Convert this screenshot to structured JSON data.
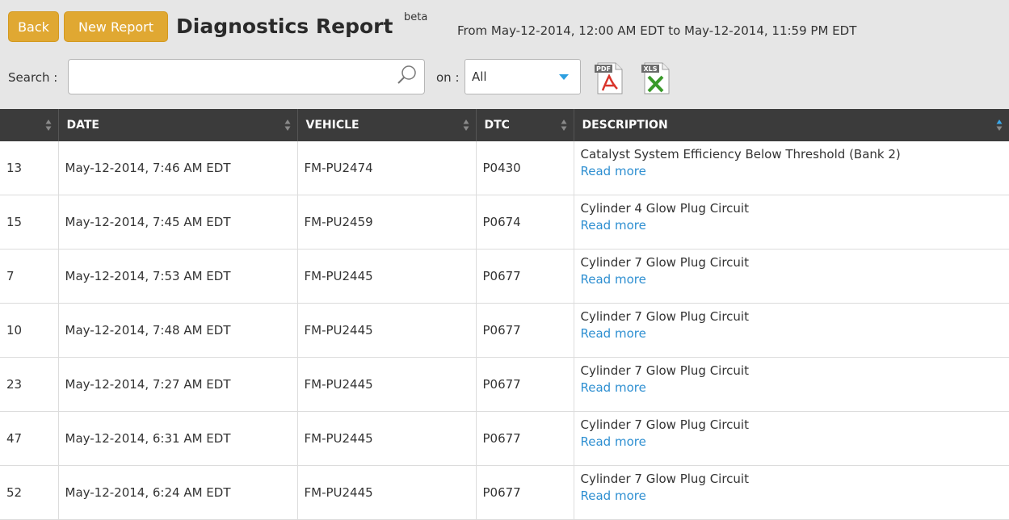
{
  "header": {
    "back_label": "Back",
    "new_report_label": "New Report",
    "title": "Diagnostics Report",
    "beta": "beta",
    "date_range": "From May-12-2014, 12:00 AM EDT to May-12-2014, 11:59 PM EDT"
  },
  "search": {
    "label": "Search :",
    "value": "",
    "placeholder": "",
    "on_label": "on :",
    "selected": "All"
  },
  "exports": {
    "pdf": "PDF",
    "xls": "XLS"
  },
  "table": {
    "columns": [
      "",
      "DATE",
      "VEHICLE",
      "DTC",
      "DESCRIPTION"
    ],
    "rows": [
      {
        "id": "13",
        "date": "May-12-2014, 7:46 AM EDT",
        "vehicle": "FM-PU2474",
        "dtc": "P0430",
        "description": "Catalyst System Efficiency Below Threshold (Bank 2)",
        "link": "Read more"
      },
      {
        "id": "15",
        "date": "May-12-2014, 7:45 AM EDT",
        "vehicle": "FM-PU2459",
        "dtc": "P0674",
        "description": "Cylinder 4 Glow Plug Circuit",
        "link": "Read more"
      },
      {
        "id": "7",
        "date": "May-12-2014, 7:53 AM EDT",
        "vehicle": "FM-PU2445",
        "dtc": "P0677",
        "description": "Cylinder 7 Glow Plug Circuit",
        "link": "Read more"
      },
      {
        "id": "10",
        "date": "May-12-2014, 7:48 AM EDT",
        "vehicle": "FM-PU2445",
        "dtc": "P0677",
        "description": "Cylinder 7 Glow Plug Circuit",
        "link": "Read more"
      },
      {
        "id": "23",
        "date": "May-12-2014, 7:27 AM EDT",
        "vehicle": "FM-PU2445",
        "dtc": "P0677",
        "description": "Cylinder 7 Glow Plug Circuit",
        "link": "Read more"
      },
      {
        "id": "47",
        "date": "May-12-2014, 6:31 AM EDT",
        "vehicle": "FM-PU2445",
        "dtc": "P0677",
        "description": "Cylinder 7 Glow Plug Circuit",
        "link": "Read more"
      },
      {
        "id": "52",
        "date": "May-12-2014, 6:24 AM EDT",
        "vehicle": "FM-PU2445",
        "dtc": "P0677",
        "description": "Cylinder 7 Glow Plug Circuit",
        "link": "Read more"
      }
    ]
  },
  "colors": {
    "accent": "#e0a832",
    "header_bg": "#3b3b3b",
    "link": "#2e8fd1",
    "topbar": "#e6e6e6"
  }
}
